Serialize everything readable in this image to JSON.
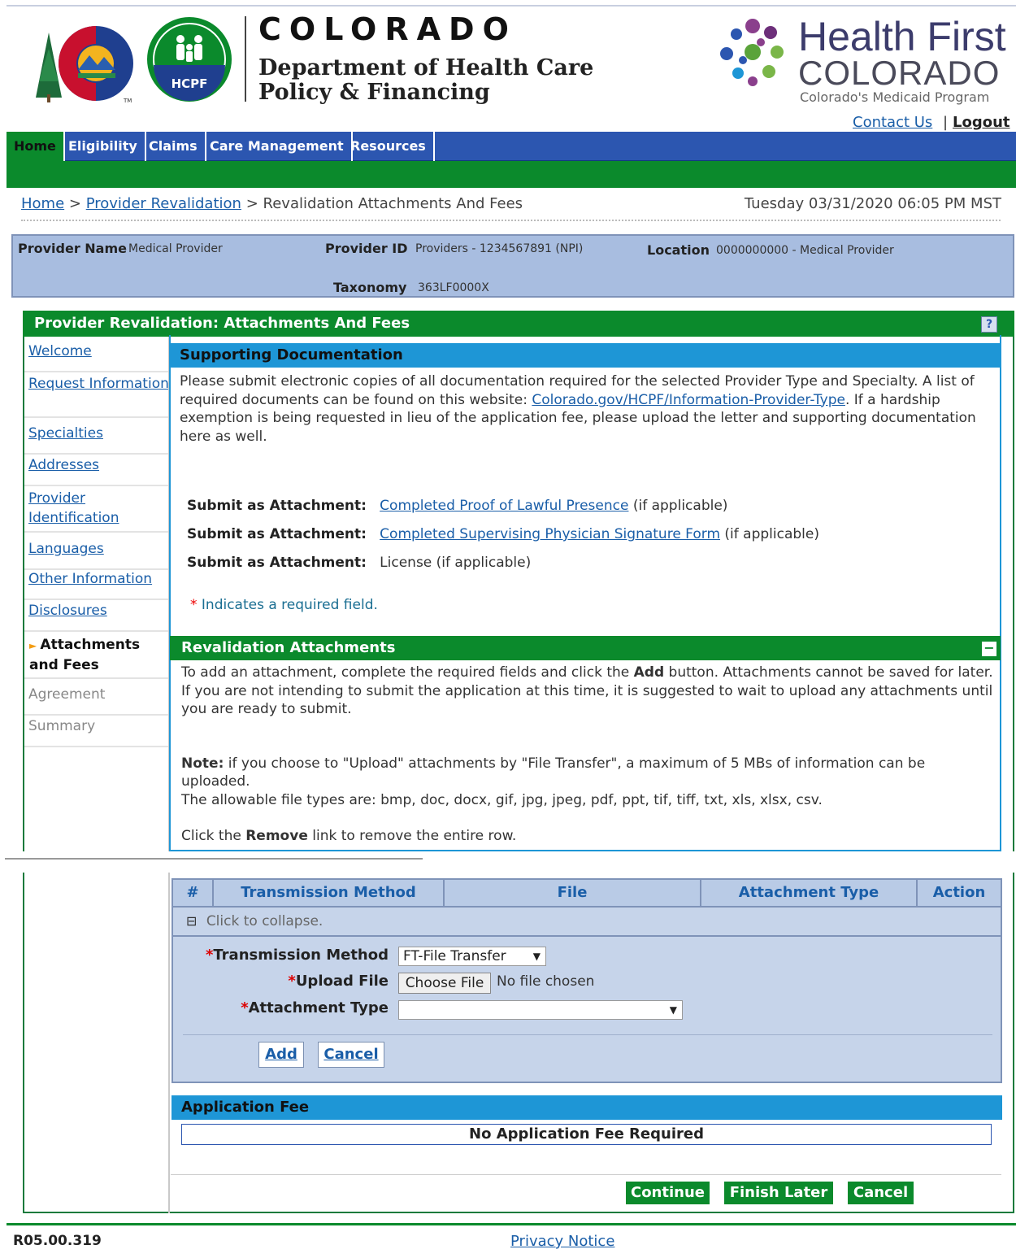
{
  "header": {
    "state_name": "COLORADO",
    "dept_line1": "Department of Health Care",
    "dept_line2": "Policy & Financing",
    "hcpf_badge": "HCPF",
    "health_first_line1": "Health First",
    "health_first_line2": "COLORADO",
    "health_first_tagline": "Colorado's Medicaid Program",
    "contact_us": "Contact Us",
    "separator": "|",
    "logout": "Logout"
  },
  "nav": {
    "items": [
      {
        "label": "Home",
        "active": true
      },
      {
        "label": "Eligibility",
        "active": false
      },
      {
        "label": "Claims",
        "active": false
      },
      {
        "label": "Care Management",
        "active": false
      },
      {
        "label": "Resources",
        "active": false
      }
    ]
  },
  "breadcrumb": {
    "home": "Home",
    "sep1": ">",
    "revalidation": "Provider Revalidation",
    "sep2": ">",
    "current": "Revalidation Attachments And Fees",
    "timestamp": "Tuesday 03/31/2020 06:05 PM MST"
  },
  "provider": {
    "name_label": "Provider Name",
    "name_value": "Medical Provider",
    "id_label": "Provider ID",
    "id_value": "Providers - 1234567891 (NPI)",
    "location_label": "Location",
    "location_value": "0000000000 - Medical Provider",
    "taxonomy_label": "Taxonomy",
    "taxonomy_value": "363LF0000X"
  },
  "panel": {
    "title": "Provider Revalidation: Attachments And Fees",
    "help_icon": "?"
  },
  "side_nav": {
    "items": [
      {
        "label": "Welcome",
        "state": "link"
      },
      {
        "label": "Request Information",
        "state": "link"
      },
      {
        "label": "Specialties",
        "state": "link"
      },
      {
        "label": "Addresses",
        "state": "link"
      },
      {
        "label": "Provider Identification",
        "state": "link"
      },
      {
        "label": "Languages",
        "state": "link"
      },
      {
        "label": "Other Information",
        "state": "link"
      },
      {
        "label": "Disclosures",
        "state": "link"
      },
      {
        "label": "Attachments and Fees",
        "state": "current"
      },
      {
        "label": "Agreement",
        "state": "disabled"
      },
      {
        "label": "Summary",
        "state": "disabled"
      }
    ]
  },
  "supporting": {
    "title": "Supporting Documentation",
    "text_before": "Please submit electronic copies of all documentation required for the selected Provider Type and Specialty. A list of required documents can be found on this website: ",
    "link": "Colorado.gov/HCPF/Information-Provider-Type",
    "text_after": ". If a hardship exemption is being requested in lieu of the application fee, please upload the letter and supporting documentation here as well.",
    "attachments": [
      {
        "label": "Submit as Attachment:",
        "link": "Completed Proof of Lawful Presence",
        "suffix": "(if applicable)"
      },
      {
        "label": "Submit as Attachment:",
        "link": "Completed Supervising Physician Signature Form",
        "suffix": "(if applicable)"
      },
      {
        "label": "Submit as Attachment:",
        "text": "License",
        "suffix": "(if applicable)"
      }
    ],
    "required_star": "*",
    "required_note": "Indicates a required field."
  },
  "revalidation": {
    "title": "Revalidation Attachments",
    "collapse_icon": "−",
    "p1_a": "To add an attachment, complete the required fields and click the ",
    "p1_bold": "Add",
    "p1_b": " button. Attachments cannot be saved for later. If you are not intending to submit the application at this time, it is suggested to wait to upload any attachments until you are ready to submit.",
    "note_bold": "Note:",
    "note_text": " if you choose to \"Upload\" attachments by \"File Transfer\", a maximum of 5 MBs of information can be uploaded.",
    "filetypes": "The allowable file types are: bmp, doc, docx, gif, jpg, jpeg, pdf, ppt, tif, tiff, txt, xls, xlsx, csv.",
    "remove_a": "Click the ",
    "remove_bold": "Remove",
    "remove_b": " link to remove the entire row."
  },
  "table": {
    "columns": [
      "#",
      "Transmission Method",
      "File",
      "Attachment Type",
      "Action"
    ],
    "collapse_icon": "⊟",
    "collapse_text": "Click to collapse."
  },
  "form": {
    "star": "*",
    "transmission_label": "Transmission Method",
    "transmission_value": "FT-File Transfer",
    "upload_label": "Upload File",
    "choose_file": "Choose File",
    "no_file": "No file chosen",
    "attachment_type_label": "Attachment Type",
    "attachment_type_value": "",
    "dropdown_arrow": "▼",
    "add": "Add",
    "cancel": "Cancel"
  },
  "fee": {
    "title": "Application Fee",
    "message": "No Application Fee Required"
  },
  "actions": {
    "continue": "Continue",
    "finish_later": "Finish Later",
    "cancel": "Cancel"
  },
  "footer": {
    "version": "R05.00.319",
    "privacy": "Privacy Notice"
  },
  "colors": {
    "nav_blue": "#2c56b0",
    "green": "#0b8a2c",
    "section_blue": "#1e96d6",
    "info_blue": "#a8bde0",
    "link": "#1a5ea8"
  }
}
